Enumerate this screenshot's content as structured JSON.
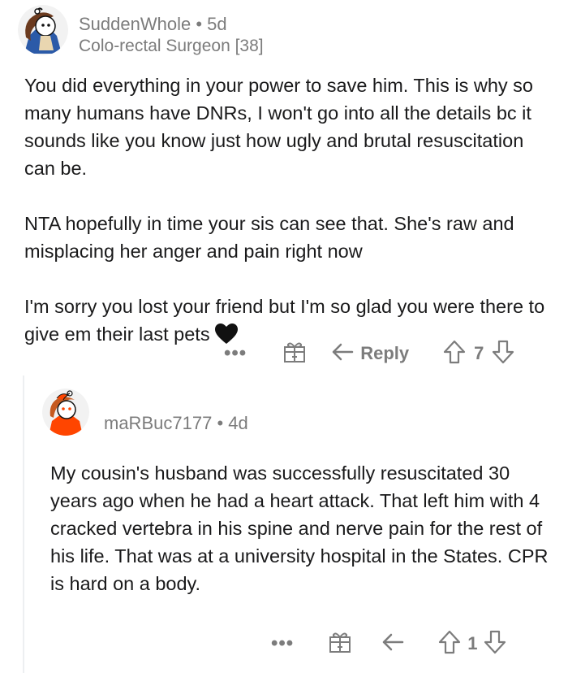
{
  "comment1": {
    "username": "SuddenWhole",
    "separator": "•",
    "age": "5d",
    "flair": "Colo-rectal Surgeon [38]",
    "paragraphs": [
      "You did everything in your power to save him. This is why so many humans have DNRs, I won't go into all the details bc it sounds like you know just how ugly and brutal resuscitation can be.",
      "NTA hopefully in time your sis can see that. She's raw and misplacing her anger and pain right now",
      "I'm sorry you lost your friend but I'm so glad you were there to give em their last pets"
    ],
    "emoji": "black-heart",
    "actions": {
      "more": "•••",
      "reply_label": "Reply",
      "score": "7"
    }
  },
  "comment2": {
    "username": "maRBuc7177",
    "separator": "•",
    "age": "4d",
    "body": "My cousin's husband was successfully resuscitated 30 years ago when he had a heart attack.  That left him with 4 cracked vertebra in his spine and  nerve pain for the rest of his life. That was at a university hospital in the States. CPR is hard on a body.",
    "actions": {
      "more": "•••",
      "score": "1"
    }
  },
  "colors": {
    "text": "#1a1a1b",
    "meta": "#7c7c7c",
    "thread_line": "#edeff1",
    "avatar2_accent": "#ff4500"
  }
}
